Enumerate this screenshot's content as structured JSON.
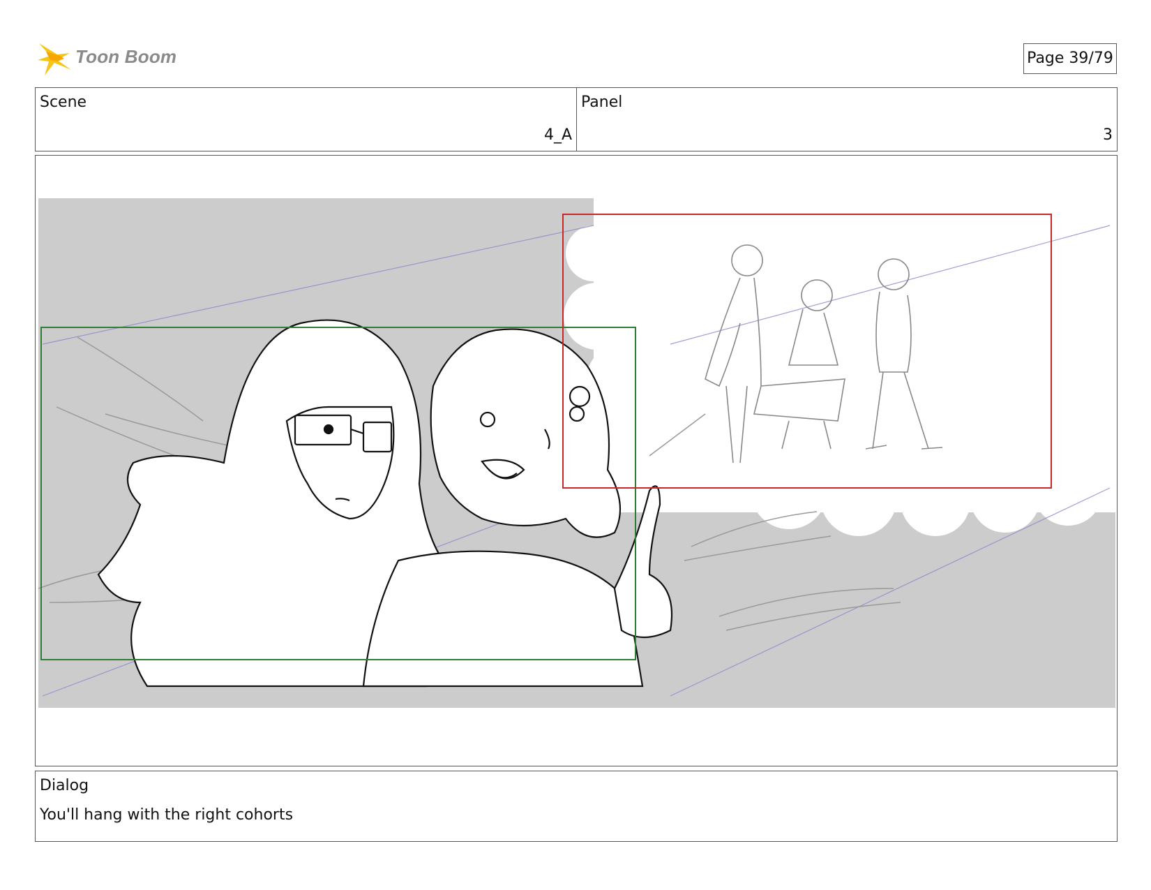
{
  "logo": {
    "brand": "Toon Boom"
  },
  "page": {
    "label": "Page 39/79"
  },
  "header": {
    "scene_label": "Scene",
    "scene_value": "4_A",
    "panel_label": "Panel",
    "panel_value": "3"
  },
  "dialog": {
    "label": "Dialog",
    "text": "You'll hang with the right cohorts"
  },
  "colors": {
    "frame_border": "#555555",
    "background_gray": "#cccccc",
    "camera_start_green": "#2e7d32",
    "camera_end_red": "#c62828",
    "perspective_blue": "#8888cc",
    "logo_yellow": "#f5c518"
  }
}
